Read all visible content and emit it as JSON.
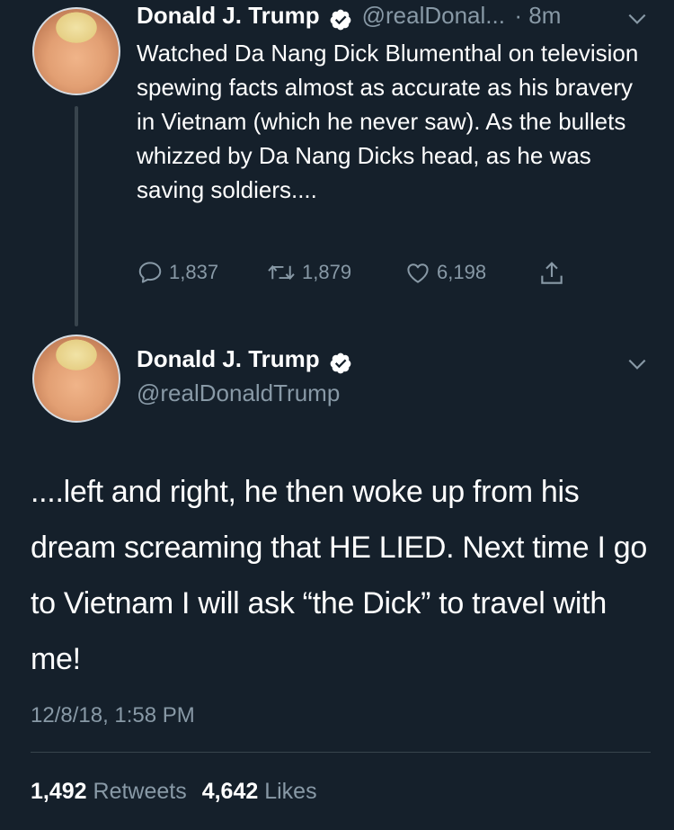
{
  "tweet1": {
    "name": "Donald J. Trump",
    "handle": "@realDonal...",
    "time": "· 8m",
    "text": "Watched Da Nang Dick Blumenthal on television spewing facts almost as accurate as his bravery in Vietnam (which he never saw). As the bullets whizzed by Da Nang Dicks head, as he was saving soldiers....",
    "replies": "1,837",
    "retweets": "1,879",
    "likes": "6,198"
  },
  "tweet2": {
    "name": "Donald J. Trump",
    "handle": "@realDonaldTrump",
    "text": "....left and right, he then woke up from his dream screaming that HE LIED. Next time I go to Vietnam I will ask “the Dick” to travel with me!",
    "timestamp": "12/8/18, 1:58 PM",
    "retweet_count": "1,492",
    "retweet_label": "Retweets",
    "like_count": "4,642",
    "like_label": "Likes"
  },
  "icons": [
    "verified-badge-icon",
    "chevron-down-icon",
    "reply-icon",
    "retweet-icon",
    "like-icon",
    "share-icon"
  ],
  "colors": {
    "background": "#15202b",
    "text_primary": "#ffffff",
    "text_secondary": "#8899a6",
    "divider": "#38444d",
    "verified_badge": "#ffffff"
  }
}
